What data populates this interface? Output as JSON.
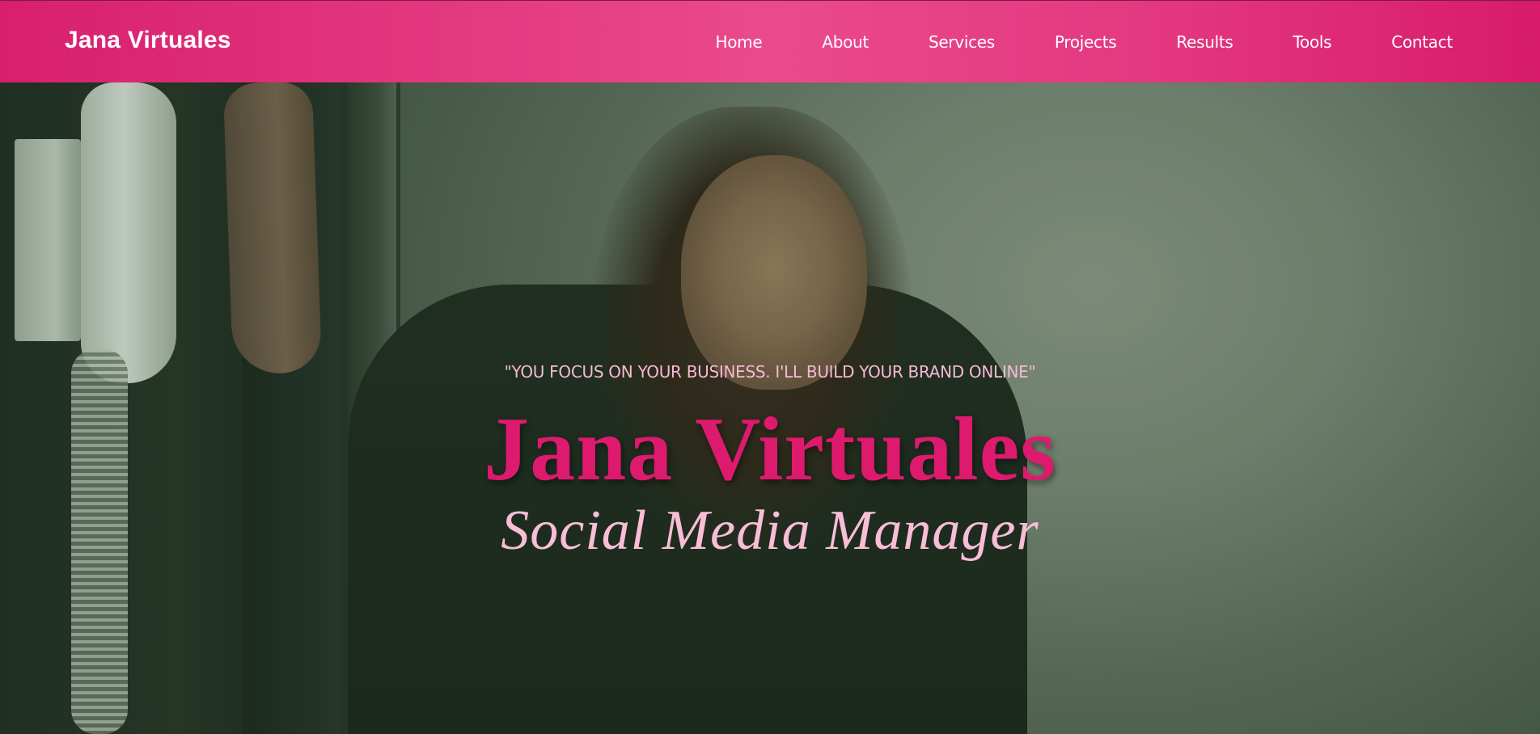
{
  "navbar": {
    "brand": "Jana Virtuales",
    "links": [
      "Home",
      "About",
      "Services",
      "Projects",
      "Results",
      "Tools",
      "Contact"
    ]
  },
  "hero": {
    "tagline": "\"YOU  FOCUS ON YOUR  BUSINESS.  I'LL  BUILD YOUR  BRAND ONLINE\"",
    "title": "Jana Virtuales",
    "subtitle": "Social Media Manager",
    "background_image": "woman-portrait-photo"
  },
  "colors": {
    "nav_pink": "#e3397f",
    "title_pink": "#dd1a6e",
    "light_pink": "#f9bdd6"
  }
}
